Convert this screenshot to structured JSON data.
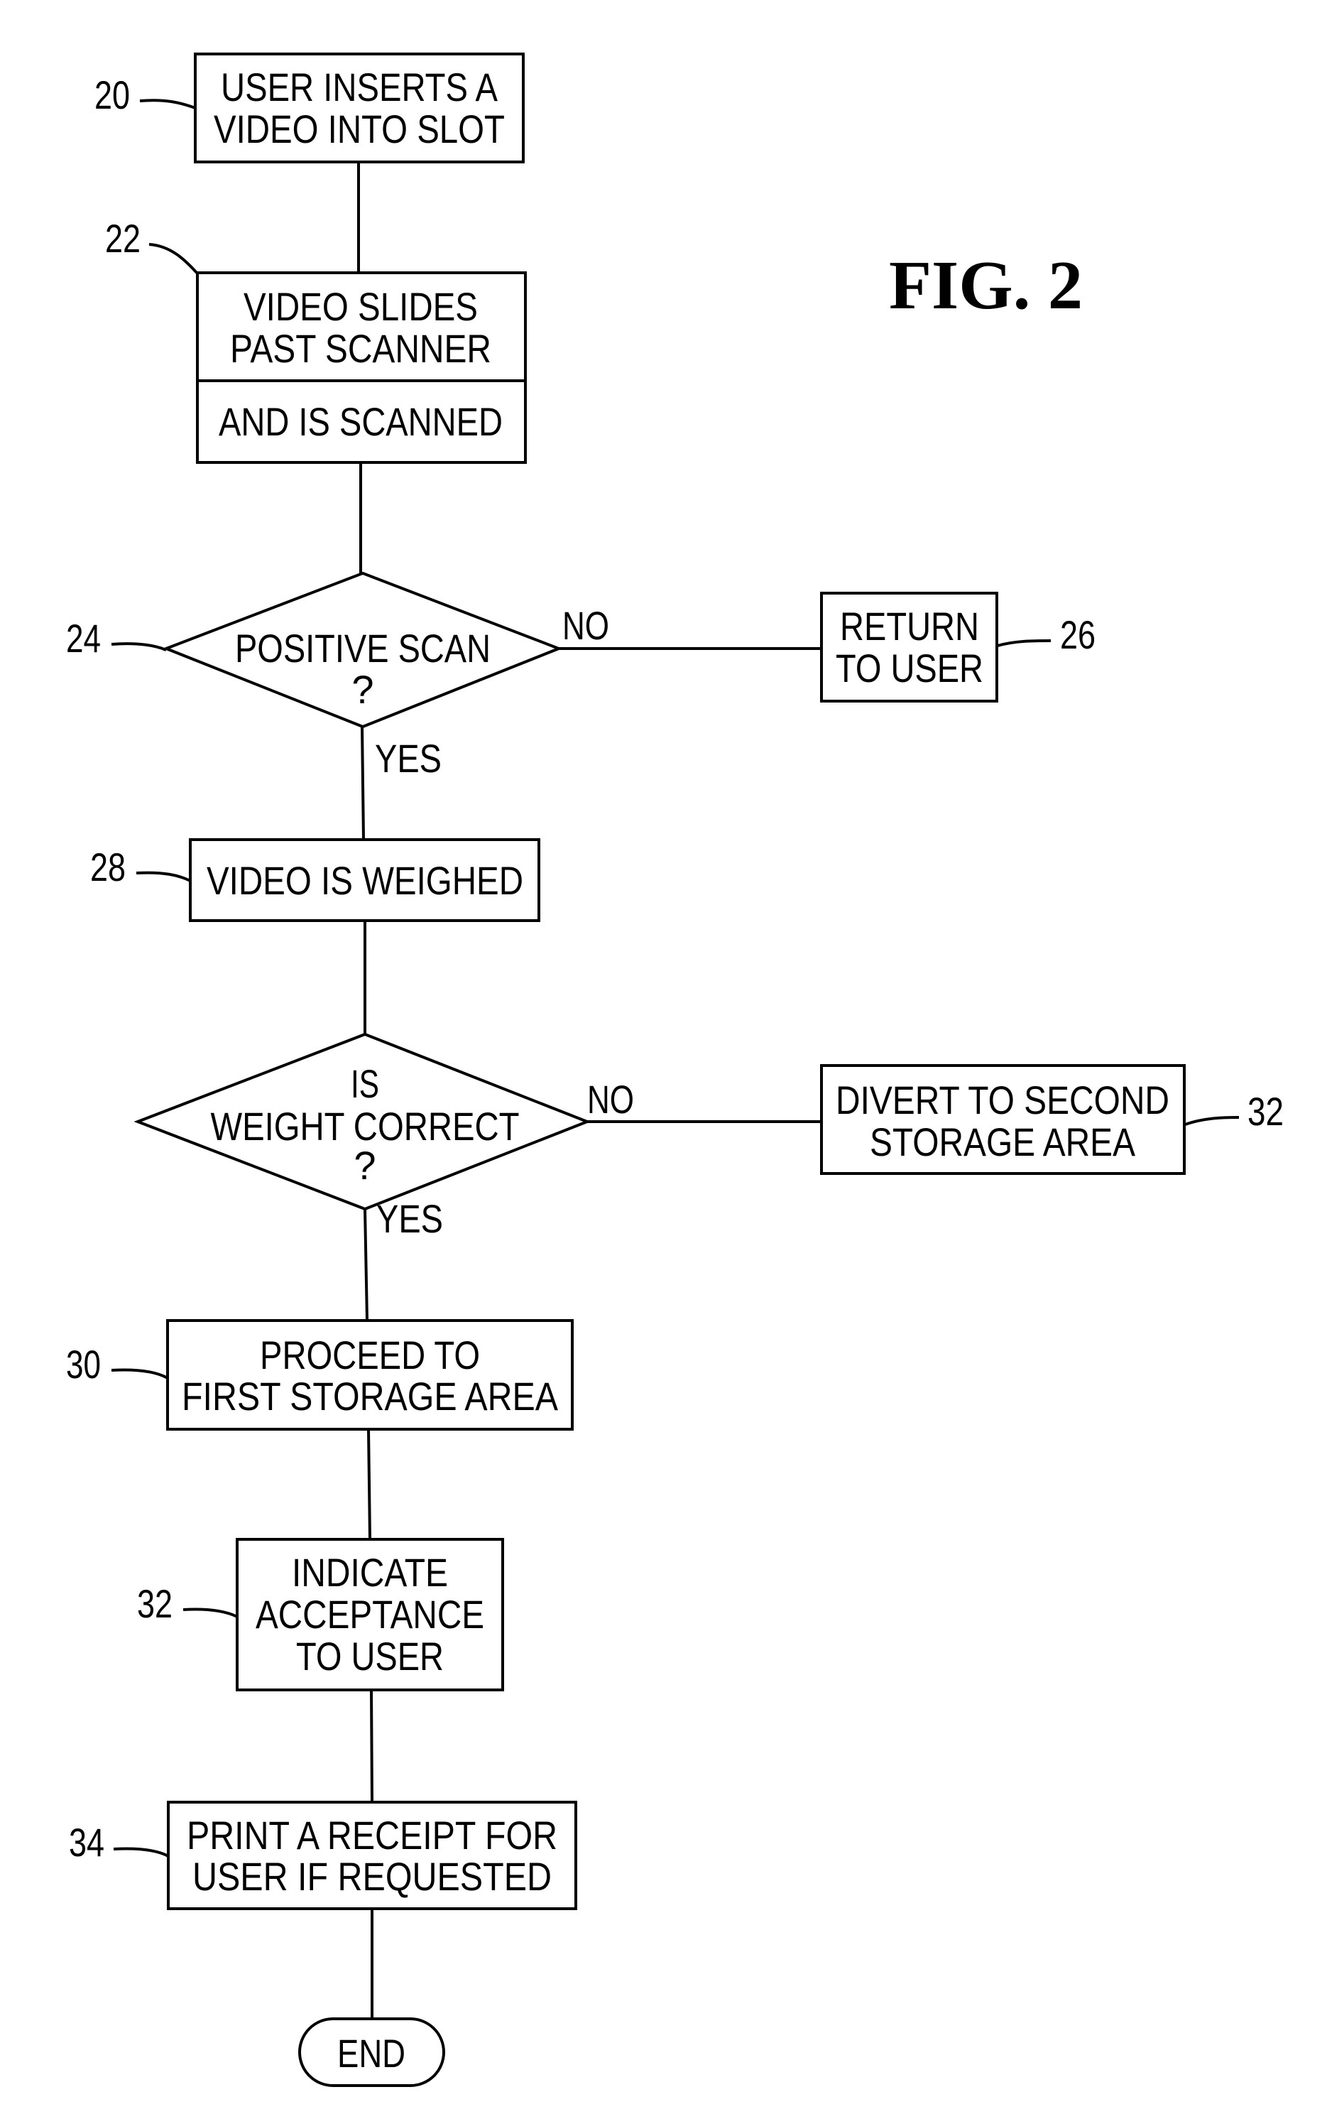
{
  "figure": {
    "title": "FIG. 2"
  },
  "nodes": {
    "n20": {
      "ref": "20",
      "type": "process",
      "lines": [
        "USER INSERTS A",
        "VIDEO INTO SLOT"
      ]
    },
    "n22": {
      "ref": "22",
      "type": "process-split",
      "lines": [
        "VIDEO SLIDES",
        "PAST SCANNER"
      ],
      "lower_lines": [
        "AND IS SCANNED"
      ]
    },
    "n24": {
      "ref": "24",
      "type": "decision",
      "lines": [
        "POSITIVE SCAN",
        "?"
      ]
    },
    "n26": {
      "ref": "26",
      "type": "process",
      "lines": [
        "RETURN",
        "TO USER"
      ]
    },
    "n28": {
      "ref": "28",
      "type": "process",
      "lines": [
        "VIDEO IS WEIGHED"
      ]
    },
    "n29": {
      "ref": "",
      "type": "decision",
      "lines": [
        "IS",
        "WEIGHT CORRECT",
        "?"
      ]
    },
    "n32a": {
      "ref": "32",
      "type": "process",
      "lines": [
        "DIVERT TO SECOND",
        "STORAGE AREA"
      ]
    },
    "n30": {
      "ref": "30",
      "type": "process",
      "lines": [
        "PROCEED TO",
        "FIRST STORAGE AREA"
      ]
    },
    "n32b": {
      "ref": "32",
      "type": "process",
      "lines": [
        "INDICATE",
        "ACCEPTANCE",
        "TO USER"
      ]
    },
    "n34": {
      "ref": "34",
      "type": "process",
      "lines": [
        "PRINT A RECEIPT FOR",
        "USER IF REQUESTED"
      ]
    },
    "end": {
      "ref": "",
      "type": "terminal",
      "lines": [
        "END"
      ]
    }
  },
  "edges": [
    {
      "from": "n20",
      "to": "n22",
      "label": ""
    },
    {
      "from": "n22",
      "to": "n24",
      "label": ""
    },
    {
      "from": "n24",
      "to": "n26",
      "label": "NO"
    },
    {
      "from": "n24",
      "to": "n28",
      "label": "YES"
    },
    {
      "from": "n28",
      "to": "n29",
      "label": ""
    },
    {
      "from": "n29",
      "to": "n32a",
      "label": "NO"
    },
    {
      "from": "n29",
      "to": "n30",
      "label": "YES"
    },
    {
      "from": "n30",
      "to": "n32b",
      "label": ""
    },
    {
      "from": "n32b",
      "to": "n34",
      "label": ""
    },
    {
      "from": "n34",
      "to": "end",
      "label": ""
    }
  ]
}
